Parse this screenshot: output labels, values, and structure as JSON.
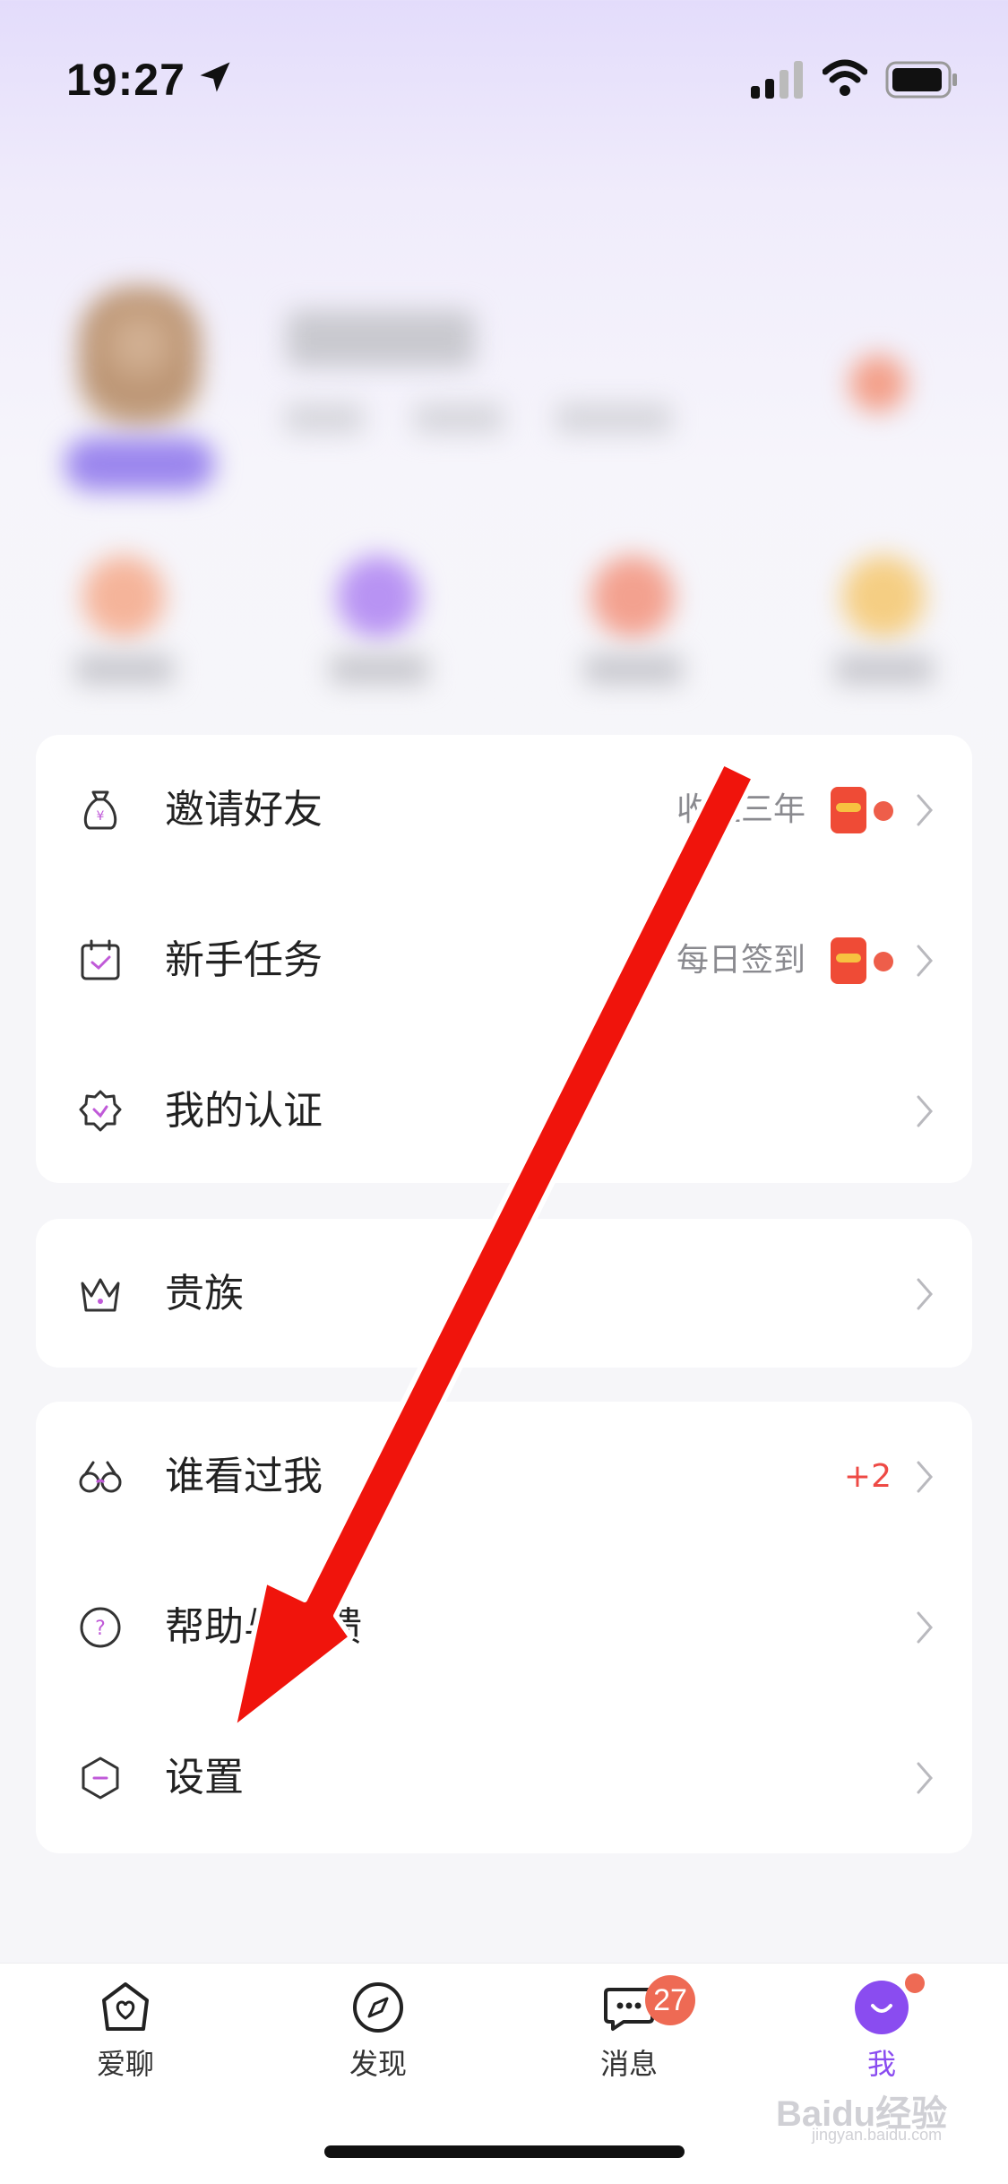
{
  "status_bar": {
    "time": "19:27"
  },
  "menu": {
    "card1": [
      {
        "label": "邀请好友",
        "right_text": "收益三年",
        "icon": "money-bag-icon",
        "has_red_packet": true,
        "has_dot": true
      },
      {
        "label": "新手任务",
        "right_text": "每日签到",
        "icon": "calendar-check-icon",
        "has_red_packet": true,
        "has_dot": true
      },
      {
        "label": "我的认证",
        "right_text": "",
        "icon": "verified-badge-icon"
      }
    ],
    "card2": [
      {
        "label": "贵族",
        "icon": "crown-icon"
      }
    ],
    "card3": [
      {
        "label": "谁看过我",
        "count": "+2",
        "icon": "glasses-icon"
      },
      {
        "label": "帮助与反馈",
        "icon": "help-circle-icon"
      },
      {
        "label": "设置",
        "icon": "settings-hexagon-icon"
      }
    ]
  },
  "tab_bar": {
    "tabs": [
      {
        "label": "爱聊",
        "icon": "home-heart-icon"
      },
      {
        "label": "发现",
        "icon": "compass-icon"
      },
      {
        "label": "消息",
        "icon": "chat-bubble-icon",
        "badge": "27"
      },
      {
        "label": "我",
        "icon": "smile-avatar-icon",
        "active": true
      }
    ]
  },
  "watermark": {
    "text": "Baidu经验",
    "sub": "jingyan.baidu.com"
  },
  "colors": {
    "accent": "#8a4cf0",
    "badge": "#ee6a54",
    "arrow": "#f0140c"
  }
}
